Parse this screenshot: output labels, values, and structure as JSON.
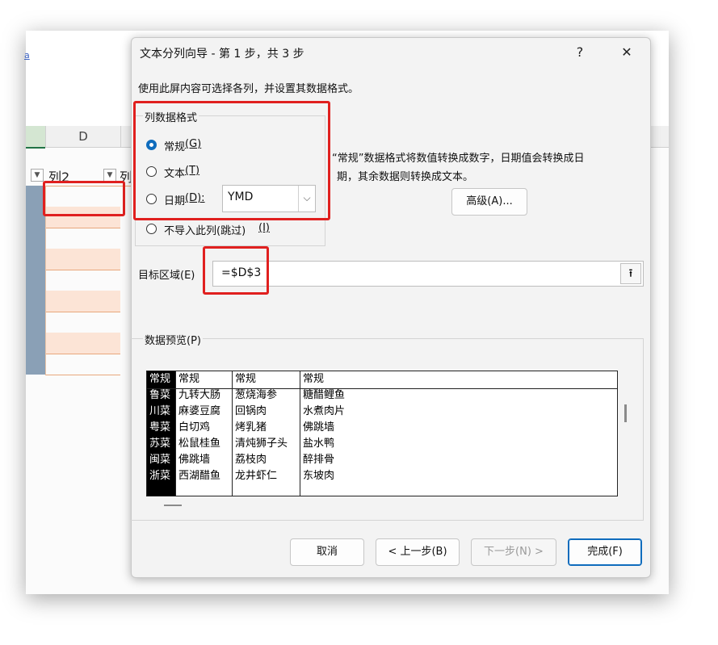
{
  "spreadsheet": {
    "link_text": "a",
    "column_header": "D",
    "header_cell_1": "列2",
    "header_cell_2": "列",
    "dropdown_glyph": "▼"
  },
  "dialog": {
    "title": "文本分列向导 - 第 1 步，共 3 步",
    "help_label": "?",
    "close_label": "✕",
    "instruction": "使用此屏内容可选择各列，并设置其数据格式。",
    "column_format": {
      "group_label": "列数据格式",
      "options": [
        {
          "label": "常规",
          "key": "(G)",
          "selected": true
        },
        {
          "label": "文本",
          "key": "(T)",
          "selected": false
        },
        {
          "label": "日期",
          "key": "(D):",
          "selected": false
        },
        {
          "label": "不导入此列(跳过)",
          "key": "(I)",
          "selected": false
        }
      ],
      "date_combo_value": "YMD"
    },
    "description_line1": "“常规”数据格式将数值转换成数字，日期值会转换成日",
    "description_line2": "期，其余数据则转换成文本。",
    "advanced_button": "高级(A)...",
    "destination": {
      "label": "目标区域(E)",
      "value": "=$D$3",
      "collapse_icon": "⭱"
    },
    "preview": {
      "label": "数据预览(P)",
      "headers": [
        "常规",
        "常规",
        "常规",
        "常规"
      ],
      "rows": [
        [
          "鲁菜",
          "九转大肠",
          "葱烧海参",
          "糖醋鲤鱼"
        ],
        [
          "川菜",
          "麻婆豆腐",
          "回锅肉",
          "水煮肉片"
        ],
        [
          "粤菜",
          "白切鸡",
          "烤乳猪",
          "佛跳墙"
        ],
        [
          "苏菜",
          "松鼠桂鱼",
          "清炖狮子头",
          "盐水鸭"
        ],
        [
          "闽菜",
          "佛跳墙",
          "荔枝肉",
          "醉排骨"
        ],
        [
          "浙菜",
          "西湖醋鱼",
          "龙井虾仁",
          "东坡肉"
        ]
      ]
    },
    "buttons": {
      "cancel": "取消",
      "back": "< 上一步(B)",
      "next": "下一步(N) >",
      "finish": "完成(F)"
    }
  },
  "colors": {
    "highlight_box": "#e0201f",
    "accent": "#0f6cbd",
    "table_band": "#fce4d6"
  }
}
